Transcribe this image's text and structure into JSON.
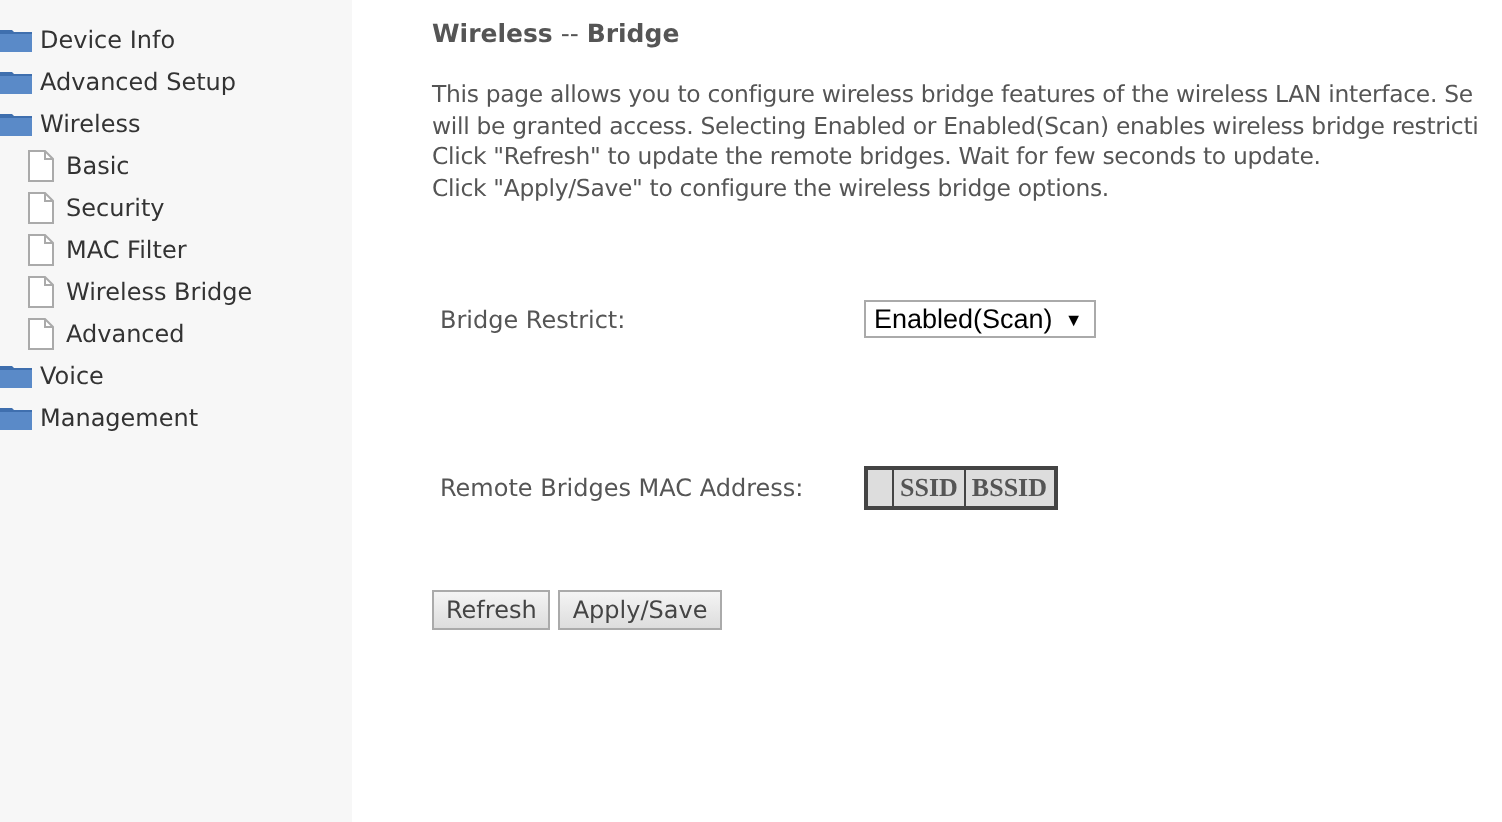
{
  "sidebar": {
    "items": [
      {
        "label": "Device Info"
      },
      {
        "label": "Advanced Setup"
      },
      {
        "label": "Wireless",
        "children": [
          {
            "label": "Basic"
          },
          {
            "label": "Security"
          },
          {
            "label": "MAC Filter"
          },
          {
            "label": "Wireless Bridge"
          },
          {
            "label": "Advanced"
          }
        ]
      },
      {
        "label": "Voice"
      },
      {
        "label": "Management"
      }
    ]
  },
  "page": {
    "title_main": "Wireless",
    "title_separator": "--",
    "title_sub": "Bridge",
    "description": [
      "This page allows you to configure wireless bridge features of the wireless LAN interface. Se",
      "will be granted access. Selecting Enabled or Enabled(Scan) enables wireless bridge restricti",
      "Click \"Refresh\" to update the remote bridges. Wait for few seconds to update.",
      "Click \"Apply/Save\" to configure the wireless bridge options."
    ],
    "bridge_restrict": {
      "label": "Bridge Restrict:",
      "value": "Enabled(Scan)",
      "arrow": "▼"
    },
    "remote_bridges": {
      "label": "Remote Bridges MAC Address:",
      "columns": [
        "SSID",
        "BSSID"
      ]
    },
    "buttons": [
      "Refresh",
      "Apply/Save"
    ]
  }
}
